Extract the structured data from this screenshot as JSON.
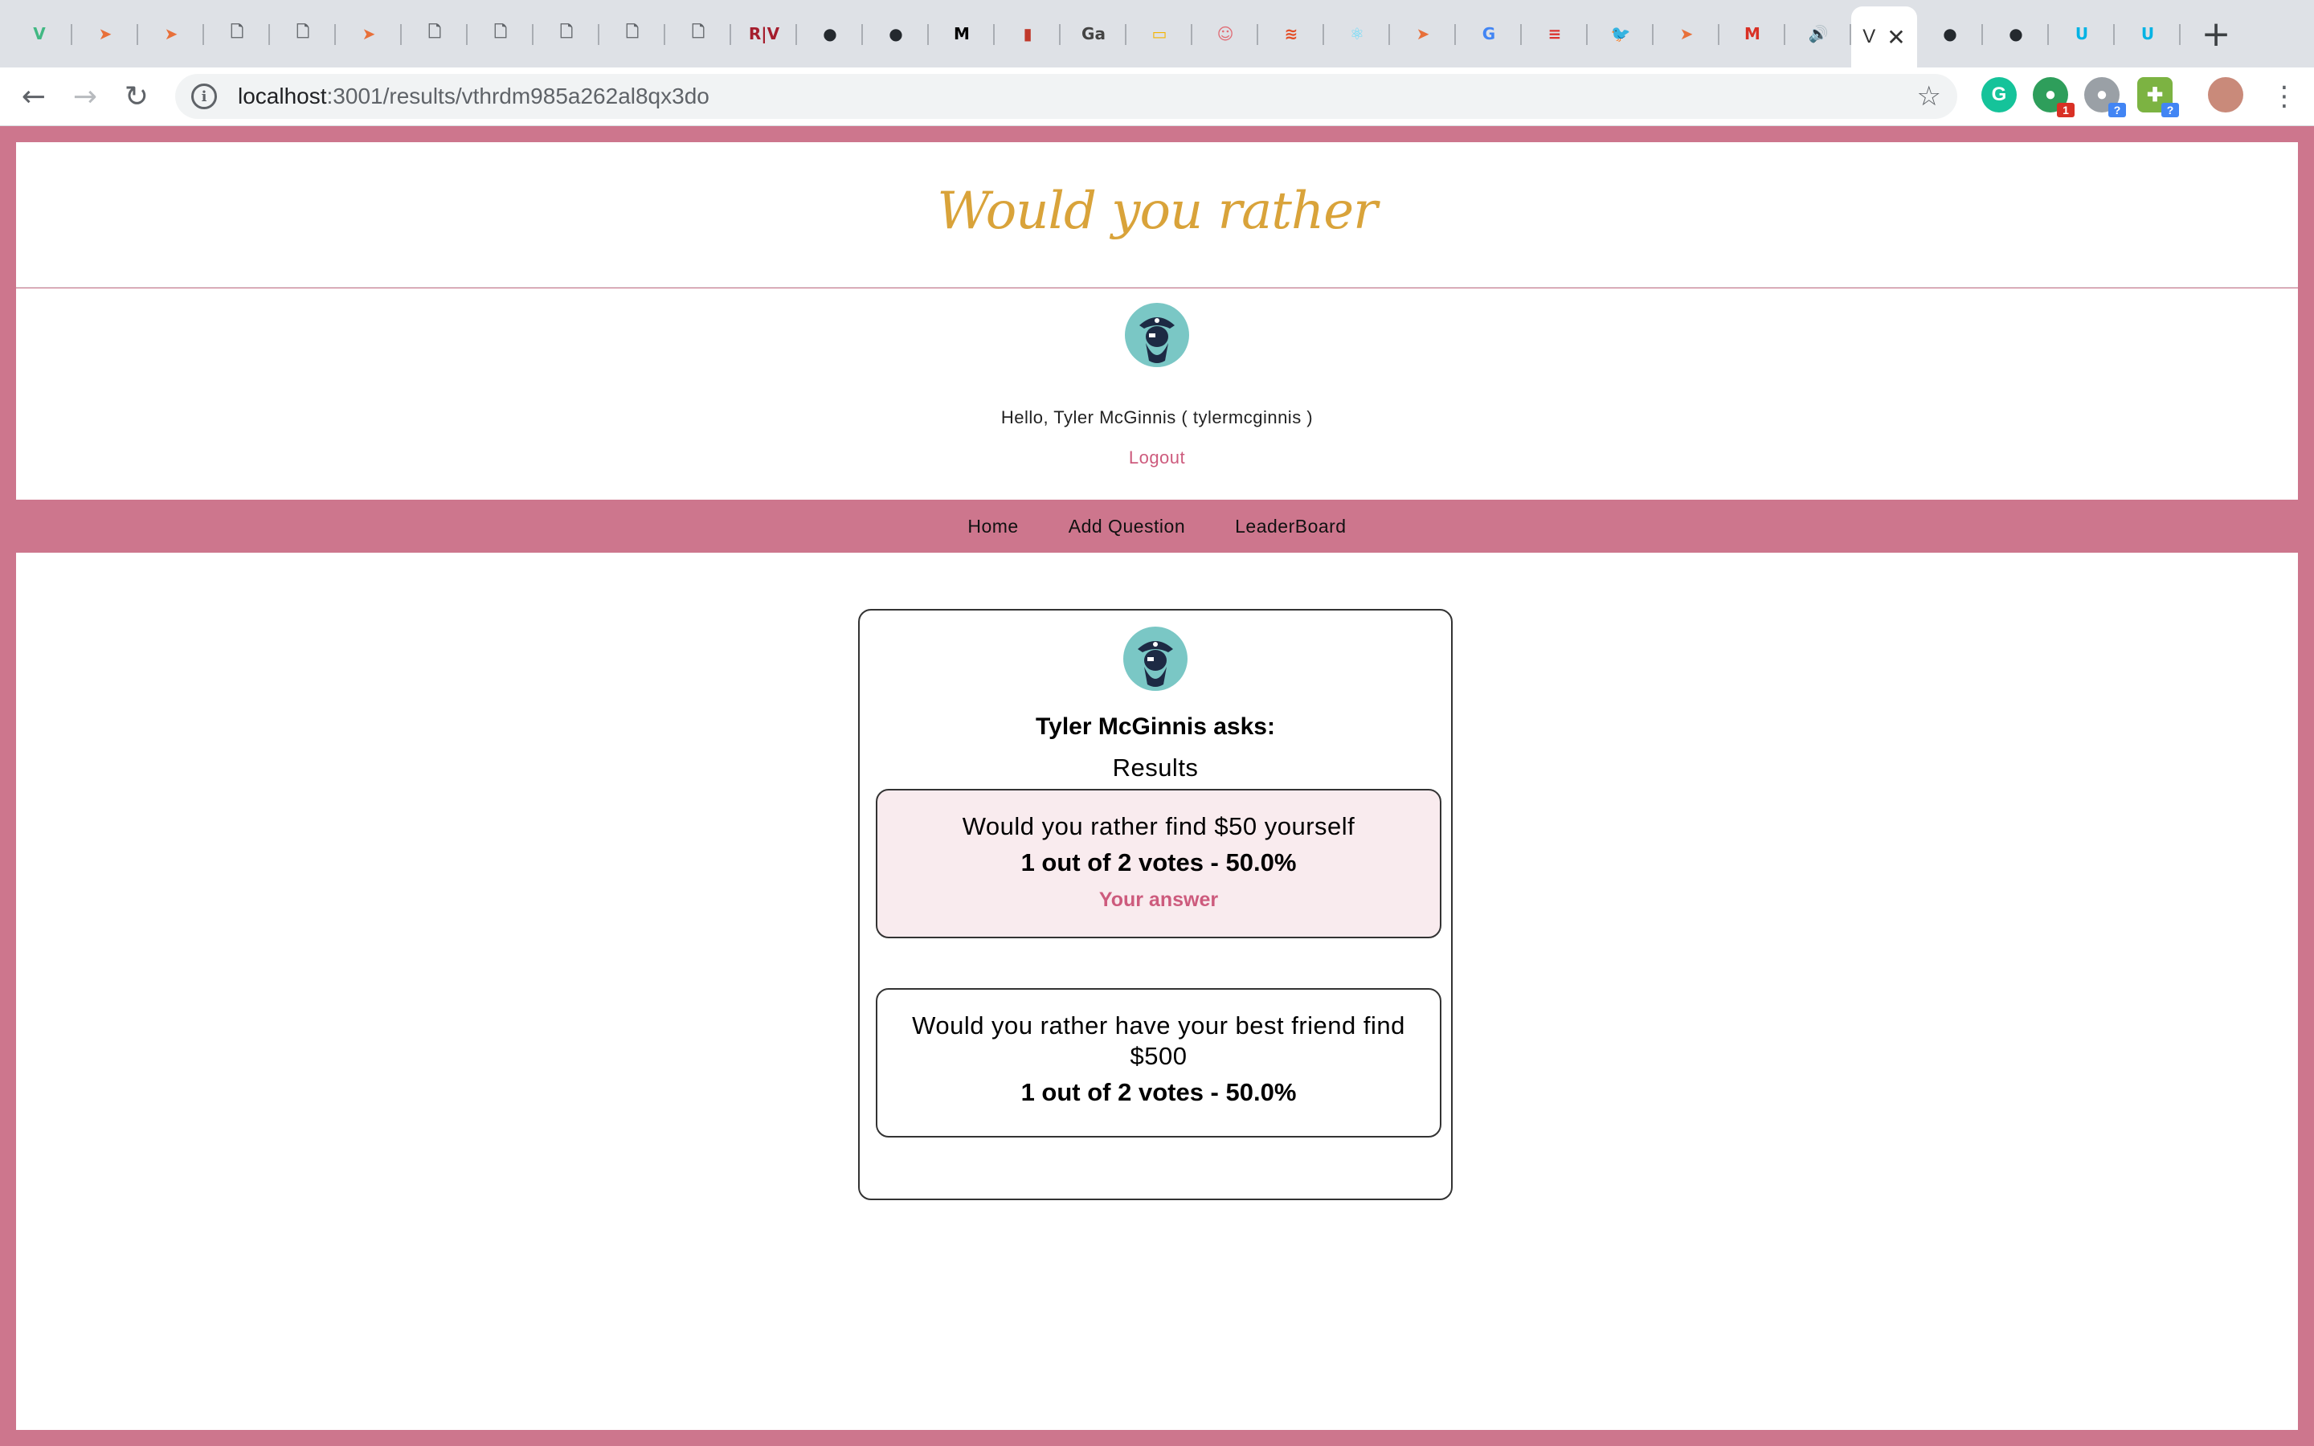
{
  "browser": {
    "tabs": [
      {
        "icon": "vue-icon",
        "glyph": "V",
        "color": "#41b883"
      },
      {
        "icon": "plane-icon",
        "glyph": "➤",
        "color": "#e8703a"
      },
      {
        "icon": "plane-icon",
        "glyph": "➤",
        "color": "#e8703a"
      },
      {
        "icon": "document-icon",
        "glyph": "🗋",
        "color": "#5f6368"
      },
      {
        "icon": "document-icon",
        "glyph": "🗋",
        "color": "#5f6368"
      },
      {
        "icon": "plane-icon",
        "glyph": "➤",
        "color": "#e8703a"
      },
      {
        "icon": "document-icon",
        "glyph": "🗋",
        "color": "#5f6368"
      },
      {
        "icon": "document-icon",
        "glyph": "🗋",
        "color": "#5f6368"
      },
      {
        "icon": "document-icon",
        "glyph": "🗋",
        "color": "#5f6368"
      },
      {
        "icon": "document-icon",
        "glyph": "🗋",
        "color": "#5f6368"
      },
      {
        "icon": "document-icon",
        "glyph": "🗋",
        "color": "#5f6368"
      },
      {
        "icon": "rv-icon",
        "glyph": "R|V",
        "color": "#a51d2d"
      },
      {
        "icon": "github-icon",
        "glyph": "●",
        "color": "#24292e"
      },
      {
        "icon": "github-icon",
        "glyph": "●",
        "color": "#24292e"
      },
      {
        "icon": "medium-icon",
        "glyph": "M",
        "color": "#000000"
      },
      {
        "icon": "ticket-icon",
        "glyph": "▮",
        "color": "#c0392b"
      },
      {
        "icon": "ga-icon",
        "glyph": "Ga",
        "color": "#444444"
      },
      {
        "icon": "slides-icon",
        "glyph": "▭",
        "color": "#f4b400"
      },
      {
        "icon": "smile-icon",
        "glyph": "☺",
        "color": "#e06c75"
      },
      {
        "icon": "slash-icon",
        "glyph": "≋",
        "color": "#e44d26"
      },
      {
        "icon": "react-icon",
        "glyph": "⚛",
        "color": "#61dafb"
      },
      {
        "icon": "plane-icon",
        "glyph": "➤",
        "color": "#e8703a"
      },
      {
        "icon": "google-icon",
        "glyph": "G",
        "color": "#4285f4"
      },
      {
        "icon": "scala-icon",
        "glyph": "≡",
        "color": "#dc322f"
      },
      {
        "icon": "twitter-icon",
        "glyph": "🐦",
        "color": "#1da1f2"
      },
      {
        "icon": "plane-icon",
        "glyph": "➤",
        "color": "#e8703a"
      },
      {
        "icon": "gmail-icon",
        "glyph": "M",
        "color": "#d93025"
      },
      {
        "icon": "audio-icon",
        "glyph": "🔊",
        "color": "#5f6368"
      }
    ],
    "active_tab": {
      "glyph": "V",
      "close": "✕"
    },
    "after_tabs": [
      {
        "icon": "github-icon",
        "glyph": "●",
        "color": "#24292e"
      },
      {
        "icon": "github-icon",
        "glyph": "●",
        "color": "#24292e"
      },
      {
        "icon": "udacity-icon",
        "glyph": "U",
        "color": "#02b3e4"
      },
      {
        "icon": "udacity-icon",
        "glyph": "U",
        "color": "#02b3e4"
      }
    ],
    "url_host": "localhost",
    "url_rest": ":3001/results/vthrdm985a262al8qx3do"
  },
  "app": {
    "title": "Would you rather",
    "greeting": "Hello, Tyler McGinnis ( tylermcginnis )",
    "logout": "Logout",
    "nav": {
      "home": "Home",
      "add_question": "Add Question",
      "leaderboard": "LeaderBoard"
    }
  },
  "question": {
    "asker": "Tyler McGinnis asks:",
    "results_label": "Results",
    "options": [
      {
        "text": "Would you rather find $50 yourself",
        "votes": "1 out of 2 votes - 50.0%",
        "your_answer": "Your answer"
      },
      {
        "text": "Would you rather have your best friend find $500",
        "votes": "1 out of 2 votes - 50.0%"
      }
    ]
  },
  "colors": {
    "brand_pink": "#cd768d",
    "accent_text_pink": "#cd5b7d",
    "title_gold": "#d9a33a",
    "avatar_teal": "#7ac7c5"
  }
}
